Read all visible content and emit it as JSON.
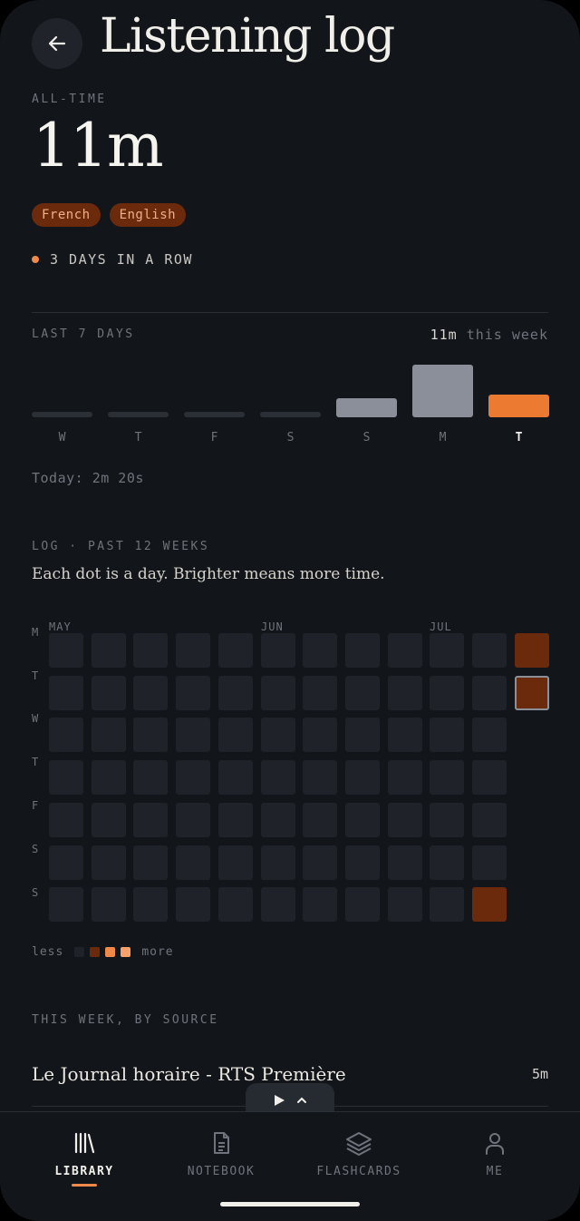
{
  "header": {
    "title": "Listening log"
  },
  "summary": {
    "label": "ALL-TIME",
    "total": "11m",
    "languages": [
      "French",
      "English"
    ],
    "streak": "3 DAYS IN A ROW"
  },
  "last7": {
    "label": "LAST 7 DAYS",
    "week_total_value": "11m",
    "week_total_suffix": "this week",
    "today_text": "Today: 2m 20s",
    "days": [
      {
        "label": "W",
        "minutes": 0,
        "today": false
      },
      {
        "label": "T",
        "minutes": 0,
        "today": false
      },
      {
        "label": "F",
        "minutes": 0,
        "today": false
      },
      {
        "label": "S",
        "minutes": 0,
        "today": false
      },
      {
        "label": "S",
        "minutes": 2.0,
        "today": false
      },
      {
        "label": "M",
        "minutes": 5.5,
        "today": false
      },
      {
        "label": "T",
        "minutes": 2.33,
        "today": true
      }
    ],
    "colors": {
      "empty": "#2b2f36",
      "past": "#8a8f99",
      "today": "#ec7a31"
    }
  },
  "log": {
    "label": "LOG · PAST 12 WEEKS",
    "description": "Each dot is a day. Brighter means more time.",
    "months": [
      "MAY",
      "JUN",
      "JUL"
    ],
    "weekdays": [
      "M",
      "T",
      "W",
      "T",
      "F",
      "S",
      "S"
    ],
    "levels": [
      [
        0,
        0,
        0,
        0,
        0,
        0,
        0,
        0,
        0,
        0,
        0,
        2
      ],
      [
        0,
        0,
        0,
        0,
        0,
        0,
        0,
        0,
        0,
        0,
        0,
        2
      ],
      [
        0,
        0,
        0,
        0,
        0,
        0,
        0,
        0,
        0,
        0,
        0,
        -1
      ],
      [
        0,
        0,
        0,
        0,
        0,
        0,
        0,
        0,
        0,
        0,
        0,
        -1
      ],
      [
        0,
        0,
        0,
        0,
        0,
        0,
        0,
        0,
        0,
        0,
        0,
        -1
      ],
      [
        0,
        0,
        0,
        0,
        0,
        0,
        0,
        0,
        0,
        0,
        0,
        -1
      ],
      [
        0,
        0,
        0,
        0,
        0,
        0,
        0,
        0,
        0,
        0,
        2,
        -1
      ]
    ],
    "today_cell": [
      1,
      11
    ],
    "level_colors": [
      "#1f2228",
      "#6b2a0c",
      "#6b2a0c",
      "#f08a4b",
      "#f6a06a"
    ],
    "legend_less": "less",
    "legend_more": "more"
  },
  "by_source": {
    "label": "THIS WEEK, BY SOURCE",
    "items": [
      {
        "title": "Le Journal horaire - RTS Première",
        "time": "5m"
      }
    ]
  },
  "tabs": [
    {
      "label": "LIBRARY",
      "icon": "library-icon",
      "active": true
    },
    {
      "label": "NOTEBOOK",
      "icon": "notebook-icon",
      "active": false
    },
    {
      "label": "FLASHCARDS",
      "icon": "flashcards-icon",
      "active": false
    },
    {
      "label": "ME",
      "icon": "profile-icon",
      "active": false
    }
  ]
}
